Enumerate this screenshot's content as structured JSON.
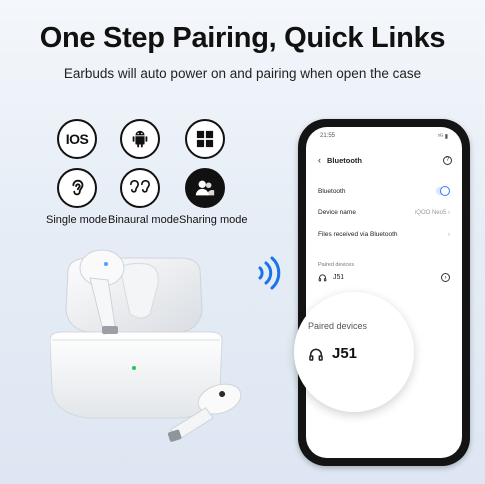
{
  "headline": "One Step Pairing, Quick Links",
  "subline": "Earbuds will auto power on and pairing when open the case",
  "features": {
    "top": [
      {
        "label": "IOS",
        "icon": "ios-icon"
      },
      {
        "label": "",
        "icon": "android-icon"
      },
      {
        "label": "",
        "icon": "windows-icon"
      }
    ],
    "modes": [
      {
        "label": "Single mode",
        "icon": "single-ear-icon"
      },
      {
        "label": "Binaural mode",
        "icon": "binaural-icon"
      },
      {
        "label": "Sharing mode",
        "icon": "sharing-icon"
      }
    ]
  },
  "phone": {
    "time": "21:55",
    "status_right": "⁵ᴳ ▮",
    "screen_title": "Bluetooth",
    "rows": {
      "bluetooth": "Bluetooth",
      "device_name_label": "Device name",
      "device_name_value": "iQOO Neo5",
      "files_received": "Files received via Bluetooth"
    },
    "paired_header": "Paired devices",
    "paired_device": "J51"
  },
  "magnifier": {
    "title": "Paired devices",
    "device": "J51"
  },
  "colors": {
    "accent_blue": "#2d7cf6",
    "wave_blue": "#1a73e8",
    "led_green": "#22c55e"
  }
}
